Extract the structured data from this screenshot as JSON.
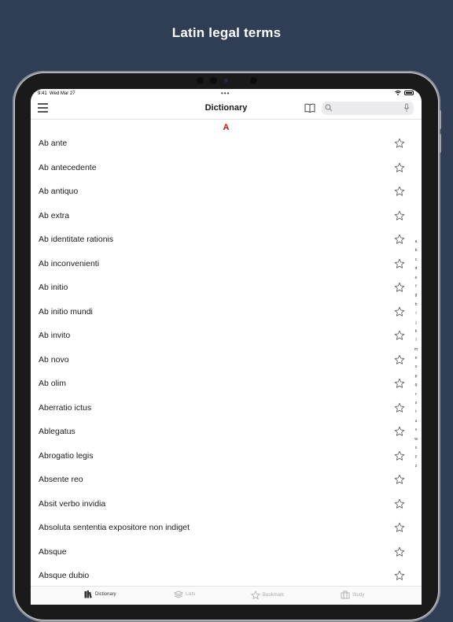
{
  "promo": {
    "title": "Latin legal terms"
  },
  "status_bar": {
    "time": "9:41",
    "date": "Wed Mar 27",
    "dots": "•••"
  },
  "nav": {
    "title": "Dictionary",
    "search_placeholder": ""
  },
  "section": {
    "letter": "A"
  },
  "terms": [
    "Ab ante",
    "Ab antecedente",
    "Ab antiquo",
    "Ab extra",
    "Ab identitate rationis",
    "Ab inconvenienti",
    "Ab initio",
    "Ab initio mundi",
    "Ab invito",
    "Ab novo",
    "Ab olim",
    "Aberratio ictus",
    "Ablegatus",
    "Abrogatio legis",
    "Absente reo",
    "Absit verbo invidia",
    "Absoluta sententia expositore non indiget",
    "Absque",
    "Absque dubio"
  ],
  "alpha_index": [
    "a",
    "b",
    "c",
    "d",
    "e",
    "f",
    "g",
    "h",
    "i",
    "j",
    "k",
    "l",
    "m",
    "n",
    "o",
    "p",
    "q",
    "r",
    "s",
    "t",
    "u",
    "v",
    "w",
    "x",
    "y",
    "z"
  ],
  "tabs": [
    {
      "label": "Dictionary",
      "icon": "dictionary-icon",
      "active": true
    },
    {
      "label": "Lists",
      "icon": "lists-icon",
      "active": false
    },
    {
      "label": "Bookmark",
      "icon": "bookmark-star-icon",
      "active": false
    },
    {
      "label": "Study",
      "icon": "study-icon",
      "active": false
    }
  ],
  "colors": {
    "background": "#2f3e55",
    "accent_red": "#c8151b"
  }
}
